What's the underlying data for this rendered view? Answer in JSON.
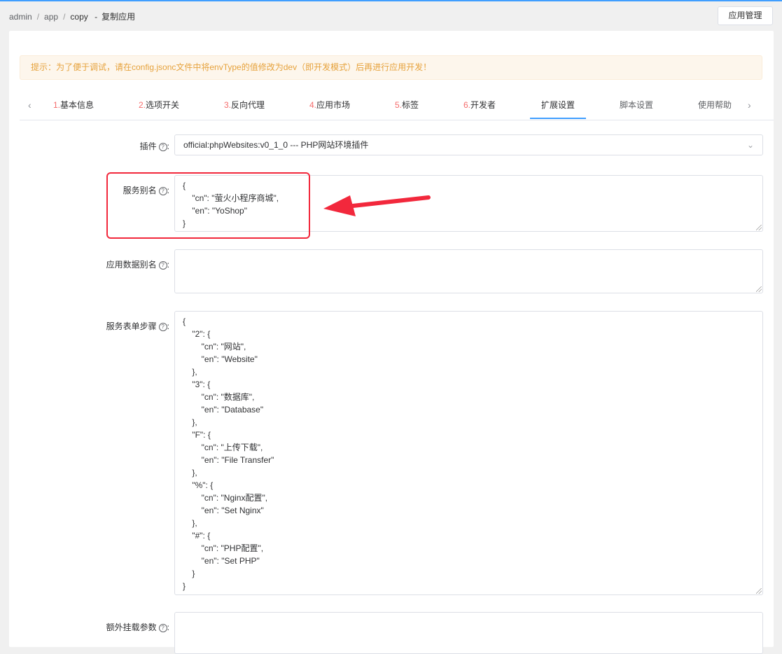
{
  "breadcrumb": {
    "admin": "admin",
    "app": "app",
    "copy": "copy",
    "dash": "-",
    "title": "复制应用"
  },
  "header": {
    "app_manage_label": "应用管理"
  },
  "alert": {
    "text": "提示：为了便于调试，请在config.jsonc文件中将envType的值修改为dev（即开发模式）后再进行应用开发！"
  },
  "tabs": [
    {
      "num": "1.",
      "label": "基本信息"
    },
    {
      "num": "2.",
      "label": "选项开关"
    },
    {
      "num": "3.",
      "label": "反向代理"
    },
    {
      "num": "4.",
      "label": "应用市场"
    },
    {
      "num": "5.",
      "label": "标签"
    },
    {
      "num": "6.",
      "label": "开发者"
    },
    {
      "num": "",
      "label": "扩展设置"
    },
    {
      "num": "",
      "label": "脚本设置"
    },
    {
      "num": "",
      "label": "使用帮助"
    }
  ],
  "form": {
    "plugin": {
      "label": "插件",
      "value": "official:phpWebsites:v0_1_0 --- PHP网站环境插件"
    },
    "service_alias": {
      "label": "服务别名",
      "value": "{\n    \"cn\": \"萤火小程序商城\",\n    \"en\": \"YoShop\"\n}"
    },
    "data_alias": {
      "label": "应用数据别名",
      "value": ""
    },
    "form_steps": {
      "label": "服务表单步骤",
      "value": "{\n    \"2\": {\n        \"cn\": \"网站\",\n        \"en\": \"Website\"\n    },\n    \"3\": {\n        \"cn\": \"数据库\",\n        \"en\": \"Database\"\n    },\n    \"F\": {\n        \"cn\": \"上传下载\",\n        \"en\": \"File Transfer\"\n    },\n    \"%\": {\n        \"cn\": \"Nginx配置\",\n        \"en\": \"Set Nginx\"\n    },\n    \"#\": {\n        \"cn\": \"PHP配置\",\n        \"en\": \"Set PHP\"\n    }\n}"
    },
    "extra_mount": {
      "label": "额外挂载参数",
      "value": ""
    }
  },
  "colors": {
    "accent": "#409eff",
    "annotation_red": "#f2283c",
    "tab_number": "#f56c6c",
    "alert_text": "#e6a23c"
  }
}
